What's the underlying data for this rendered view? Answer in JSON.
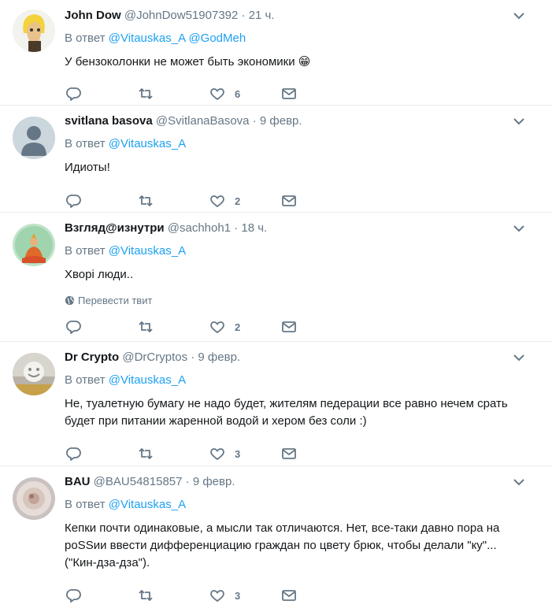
{
  "replying_to": "В ответ",
  "translate_label": "Перевести твит",
  "tweets": [
    {
      "name": "John Dow",
      "handle": "@JohnDow51907392",
      "time": "21 ч.",
      "mentions": [
        "@Vitauskas_A",
        "@GodMeh"
      ],
      "text": "У бензоколонки не может быть экономики 😁",
      "likes": "6"
    },
    {
      "name": "svitlana basova",
      "handle": "@SvitlanaBasova",
      "time": "9 февр.",
      "mentions": [
        "@Vitauskas_A"
      ],
      "text": "Идиоты!",
      "likes": "2"
    },
    {
      "name": "Взгляд@изнутри",
      "handle": "@sachhoh1",
      "time": "18 ч.",
      "mentions": [
        "@Vitauskas_A"
      ],
      "text": "Хворі люди..",
      "likes": "2"
    },
    {
      "name": "Dr Crypto",
      "handle": "@DrCryptos",
      "time": "9 февр.",
      "mentions": [
        "@Vitauskas_A"
      ],
      "text": "Не, туалетную бумагу не надо будет, жителям педерации все равно нечем срать будет при питании жаренной водой и хером без соли  :)",
      "likes": "3"
    },
    {
      "name": "BAU",
      "handle": "@BAU54815857",
      "time": "9 февр.",
      "mentions": [
        "@Vitauskas_A"
      ],
      "text": "Кепки почти одинаковые, а мысли так отличаются. Нет, все-таки давно пора на poSSии ввести дифференциацию граждан по цвету брюк, чтобы делали \"ку\"... (\"Кин-дза-дза\").",
      "likes": "3"
    }
  ],
  "colors": {
    "link": "#1da1f2",
    "muted": "#657786",
    "text": "#14171a",
    "border": "#e6ecf0"
  }
}
